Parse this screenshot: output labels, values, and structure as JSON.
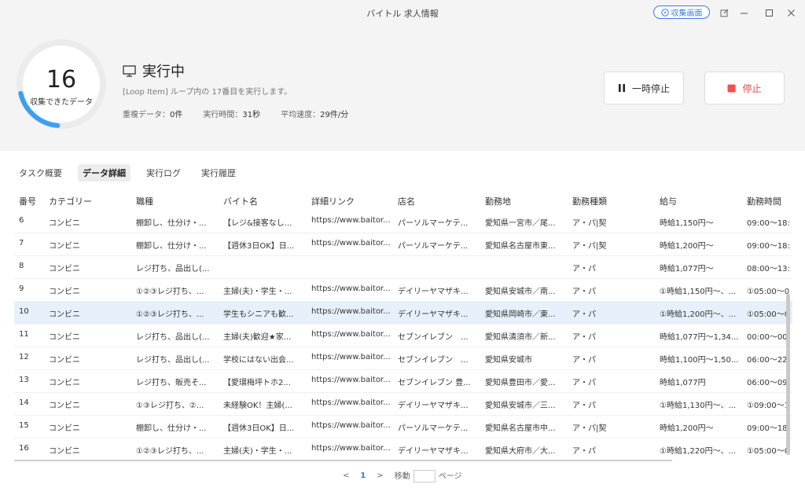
{
  "window": {
    "title": "バイトル 求人情報",
    "collect_view_label": "収集画面"
  },
  "progress": {
    "count": "16",
    "count_label": "収集できたデータ",
    "ring_fraction": 0.2,
    "accent": "#3a9ff0"
  },
  "status": {
    "label": "実行中",
    "loop_message": "[Loop Item] ループ内の 17番目を実行します。",
    "stats": [
      {
        "label": "重複データ：",
        "value": "0件"
      },
      {
        "label": "実行時間：",
        "value": "31秒"
      },
      {
        "label": "平均速度：",
        "value": "29件/分"
      }
    ]
  },
  "controls": {
    "pause_label": "一時停止",
    "stop_label": "停止",
    "stop_color": "#ef5350"
  },
  "tabs": [
    "タスク概要",
    "データ詳細",
    "実行ログ",
    "実行履歴"
  ],
  "table": {
    "headers": [
      "番号",
      "カテゴリー",
      "職種",
      "バイト名",
      "詳細リンク",
      "店名",
      "勤務地",
      "勤務種類",
      "給与",
      "勤務時間"
    ],
    "rows": [
      [
        "6",
        "コンビニ",
        "棚卸し、仕分け・...",
        "【レジ&接客なし...",
        "https://www.baitor...",
        "パーソルマーケテ...",
        "愛知県一宮市／尾...",
        "ア・パ|契",
        "時給1,150円～",
        "09:00～18:"
      ],
      [
        "7",
        "コンビニ",
        "棚卸し、仕分け・...",
        "【週休3日OK】日...",
        "https://www.baitor...",
        "パーソルマーケテ...",
        "愛知県名古屋市東...",
        "ア・パ|契",
        "時給1,200円～",
        "09:00～18:"
      ],
      [
        "8",
        "コンビニ",
        "レジ打ち、品出し(...",
        "",
        "",
        "",
        "",
        "ア・パ",
        "時給1,077円～",
        "08:00～13:"
      ],
      [
        "9",
        "コンビニ",
        "①②③レジ打ち、...",
        "主婦(夫)・学生・...",
        "https://www.baitor...",
        "デイリーヤマザキ...",
        "愛知県安城市／南...",
        "ア・パ",
        "①時給1,150円～、...",
        "①05:00～0"
      ],
      [
        "10",
        "コンビニ",
        "①②③レジ打ち、...",
        "学生もシニアも歓...",
        "https://www.baitor...",
        "デイリーヤマザキ...",
        "愛知県岡崎市／東...",
        "ア・パ",
        "①時給1,200円～、...",
        "①05:00～0"
      ],
      [
        "11",
        "コンビニ",
        "レジ打ち、品出し(...",
        "主婦(夫)歓迎★家...",
        "https://www.baitor...",
        "セブンイレブン　...",
        "愛知県清須市／新...",
        "ア・パ",
        "時給1,077円～1,34...",
        "00:00～00:"
      ],
      [
        "12",
        "コンビニ",
        "レジ打ち、品出し(...",
        "学校にはない出会...",
        "https://www.baitor...",
        "セブンイレブン　...",
        "愛知県安城市",
        "ア・パ",
        "時給1,100円～1,50...",
        "06:00～22:"
      ],
      [
        "13",
        "コンビニ",
        "レジ打ち、販売そ...",
        "【愛環梅坪トホ2...",
        "https://www.baitor...",
        "セブンイレブン 豊...",
        "愛知県豊田市／愛...",
        "ア・パ",
        "時給1,077円",
        "06:00～09:"
      ],
      [
        "14",
        "コンビニ",
        "①③レジ打ち、②...",
        "未経験OK！主婦(...",
        "https://www.baitor...",
        "デイリーヤマザキ...",
        "愛知県安城市／三...",
        "ア・パ",
        "①時給1,130円～、...",
        "①09:00～1"
      ],
      [
        "15",
        "コンビニ",
        "棚卸し、仕分け・...",
        "【週休3日OK】日...",
        "https://www.baitor...",
        "パーソルマーケテ...",
        "愛知県名古屋市中...",
        "ア・パ|契",
        "時給1,200円～",
        "09:00～18:"
      ],
      [
        "16",
        "コンビニ",
        "①②③レジ打ち、...",
        "主婦(夫)・学生・...",
        "https://www.baitor...",
        "デイリーヤマザキ...",
        "愛知県大府市／大...",
        "ア・パ",
        "①時給1,220円～、...",
        "①05:00～0"
      ]
    ],
    "selected_row": "10"
  },
  "pagination": {
    "page": "1",
    "goto_label": "移動",
    "page_suffix": "ページ"
  }
}
